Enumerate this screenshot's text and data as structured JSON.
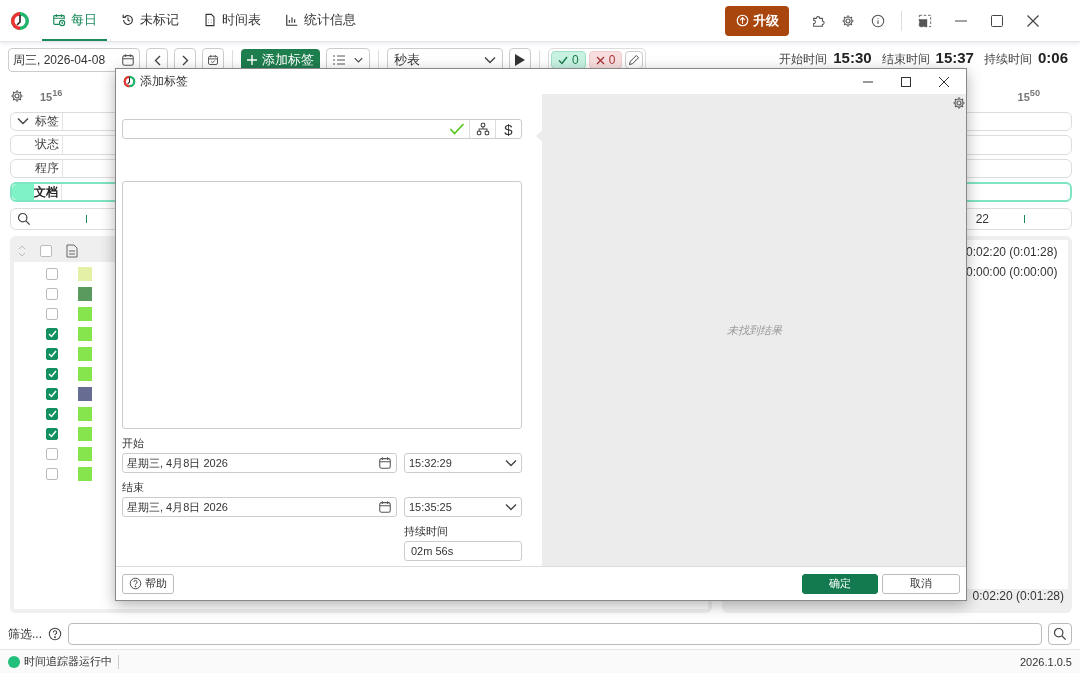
{
  "tabs": [
    {
      "label": "每日",
      "selected": true
    },
    {
      "label": "未标记",
      "selected": false
    },
    {
      "label": "时间表",
      "selected": false
    },
    {
      "label": "统计信息",
      "selected": false
    }
  ],
  "upgrade_button": "升级",
  "toolbar": {
    "date": "周三, 2026-04-08",
    "add_button": "添加标签",
    "mode_select": "秒表",
    "approved_count": "0",
    "rejected_count": "0",
    "start_label": "开始时间",
    "start_value": "15:30",
    "end_label": "结束时间",
    "end_value": "15:37",
    "duration_label": "持续时间",
    "duration_value": "0:06"
  },
  "timeline": {
    "ticks": [
      "15$^{16}$",
      "15$^{50}$"
    ],
    "rows": [
      {
        "kind": "group",
        "label": "标签",
        "selected": false
      },
      {
        "kind": "track",
        "label": "状态",
        "selected": false
      },
      {
        "kind": "track",
        "label": "程序",
        "selected": false
      },
      {
        "kind": "track",
        "label": "文档",
        "selected": true
      }
    ],
    "scale_label": "22"
  },
  "table": {
    "select_all_checked": false,
    "rows": [
      {
        "checked": false,
        "color": "#e4f0a6"
      },
      {
        "checked": false,
        "color": "#5b9a5f"
      },
      {
        "checked": false,
        "color": "#86e44c"
      },
      {
        "checked": true,
        "color": "#86e44c"
      },
      {
        "checked": true,
        "color": "#86e44c"
      },
      {
        "checked": true,
        "color": "#86e44c"
      },
      {
        "checked": true,
        "color": "#676c93"
      },
      {
        "checked": true,
        "color": "#86e44c"
      },
      {
        "checked": true,
        "color": "#86e44c"
      },
      {
        "checked": false,
        "color": "#86e44c"
      },
      {
        "checked": false,
        "color": "#86e44c"
      }
    ]
  },
  "summary": {
    "rows": [
      "0:02:20 (0:01:28)",
      "0:00:00 (0:00:00)"
    ],
    "total": "0:02:20 (0:01:28)"
  },
  "filter": {
    "label": "筛选..."
  },
  "status_bar": {
    "text": "时间追踪器运行中",
    "version": "2026.1.0.5"
  },
  "dialog": {
    "title": "添加标签",
    "currency_button": "$",
    "start_label": "开始",
    "start_date": "星期三, 4月8日 2026",
    "start_time": "15:32:29",
    "end_label": "结束",
    "end_date": "星期三, 4月8日 2026",
    "end_time": "15:35:25",
    "duration_label": "持续时间",
    "duration": "02m 56s",
    "empty_text": "未找到结果",
    "help_button": "帮助",
    "ok_button": "确定",
    "cancel_button": "取消"
  }
}
